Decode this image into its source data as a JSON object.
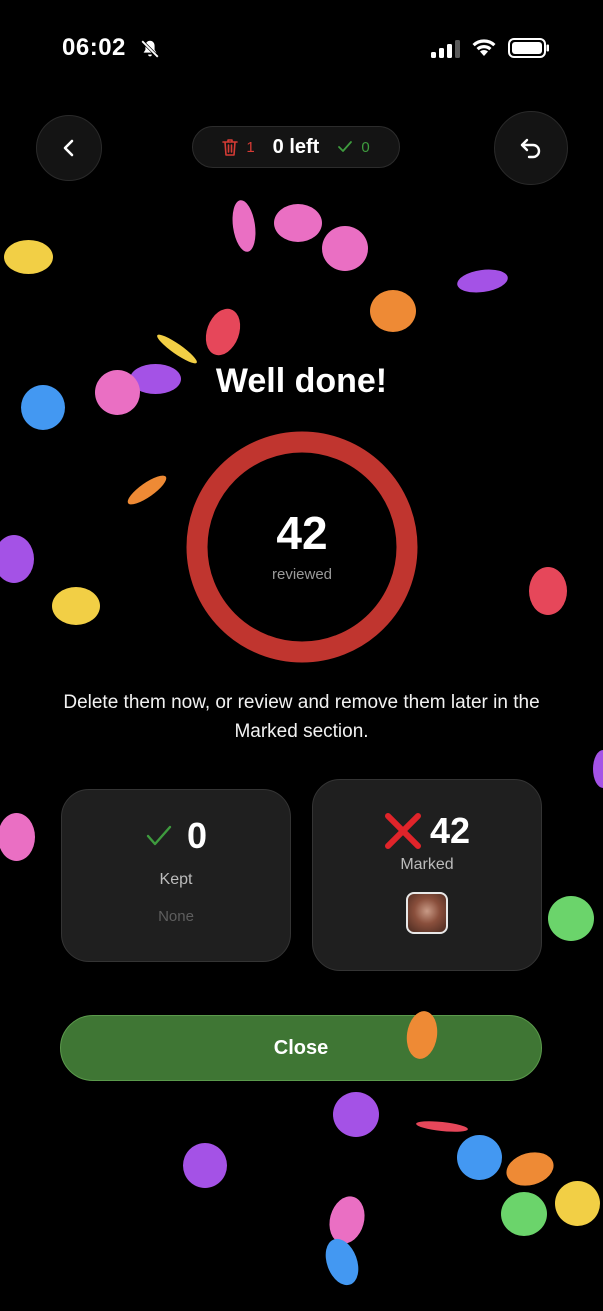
{
  "status_bar": {
    "time": "06:02",
    "icons": [
      "bell-slash-icon",
      "cellular-signal-icon",
      "wifi-icon",
      "battery-icon"
    ]
  },
  "header": {
    "back_icon": "chevron-left-icon",
    "undo_icon": "undo-arrow-icon",
    "progress": {
      "delete_icon": "trash-icon",
      "delete_count": "1",
      "left_label": "0 left",
      "keep_icon": "check-icon",
      "keep_count": "0"
    }
  },
  "summary": {
    "headline": "Well done!",
    "reviewed_count": "42",
    "reviewed_label": "reviewed",
    "ring_color": "#c0352f",
    "message": "Delete them now, or review and remove them later in the Marked section."
  },
  "cards": {
    "kept": {
      "icon": "check-icon",
      "count": "0",
      "label": "Kept",
      "sub": "None"
    },
    "marked": {
      "icon": "x-mark-icon",
      "count": "42",
      "label": "Marked",
      "thumbnail": "photo-thumbnail"
    }
  },
  "actions": {
    "close_label": "Close"
  },
  "colors": {
    "background": "#000000",
    "accent_green": "#3f7634",
    "delete_red": "#d53b35",
    "keep_green": "#3e9b3e"
  }
}
